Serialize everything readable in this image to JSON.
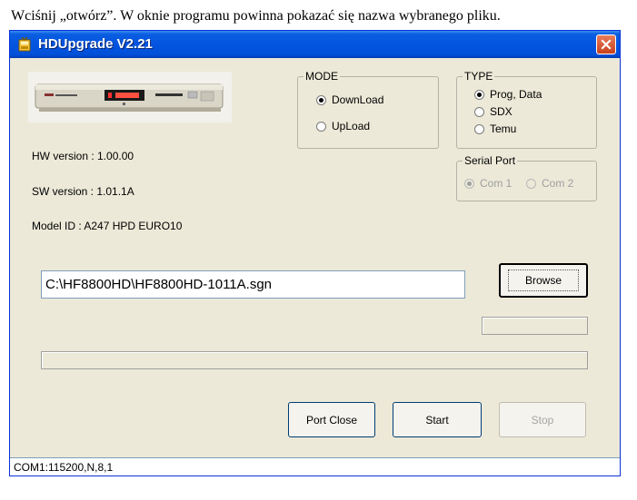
{
  "caption": "Wciśnij „otwórz”. W oknie programu powinna pokazać się nazwa wybranego pliku.",
  "window": {
    "title": "HDUpgrade V2.21",
    "icon": "app-icon",
    "close_icon": "close-icon"
  },
  "device_icon": "receiver-device-icon",
  "info": {
    "hw_version": "HW version : 1.00.00",
    "sw_version": "SW version : 1.01.1A",
    "model_id": "Model ID : A247    HPD EURO10"
  },
  "mode": {
    "legend": "MODE",
    "options": [
      {
        "label": "DownLoad",
        "selected": true
      },
      {
        "label": "UpLoad",
        "selected": false
      }
    ]
  },
  "type": {
    "legend": "TYPE",
    "options": [
      {
        "label": "Prog, Data",
        "selected": true
      },
      {
        "label": "SDX",
        "selected": false
      },
      {
        "label": "Temu",
        "selected": false
      }
    ]
  },
  "serial_port": {
    "legend": "Serial Port",
    "enabled": false,
    "options": [
      {
        "label": "Com 1",
        "selected": true
      },
      {
        "label": "Com 2",
        "selected": false
      }
    ]
  },
  "file_path": "C:\\HF8800HD\\HF8800HD-1011A.sgn",
  "buttons": {
    "browse": "Browse",
    "port_close": "Port Close",
    "start": "Start",
    "stop": "Stop"
  },
  "progress": {
    "small": 0,
    "large": 0
  },
  "status_bar": "COM1:115200,N,8,1",
  "colors": {
    "titlebar": "#0454e0",
    "window_bg": "#ece9d8",
    "close_button": "#c8401c"
  }
}
